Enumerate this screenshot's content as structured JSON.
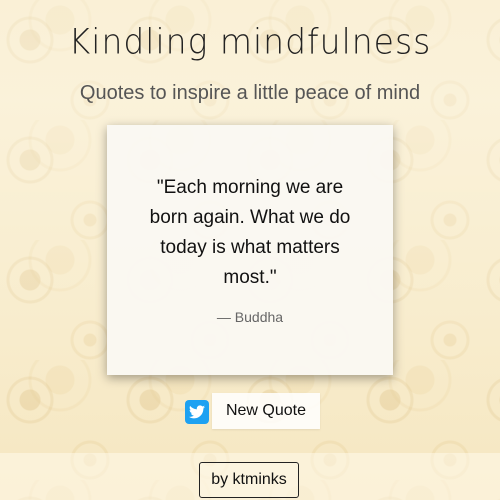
{
  "header": {
    "title": "Kindling mindfulness",
    "subtitle": "Quotes to inspire a little peace of mind"
  },
  "quote_card": {
    "text": "\"Each morning we are born again. What we do today is what matters most.\"",
    "author": "— Buddha"
  },
  "actions": {
    "tweet_icon": "twitter-icon",
    "tweet_color": "#1da1f2",
    "new_quote_label": "New Quote"
  },
  "footer": {
    "credit_label": "by ktminks"
  }
}
